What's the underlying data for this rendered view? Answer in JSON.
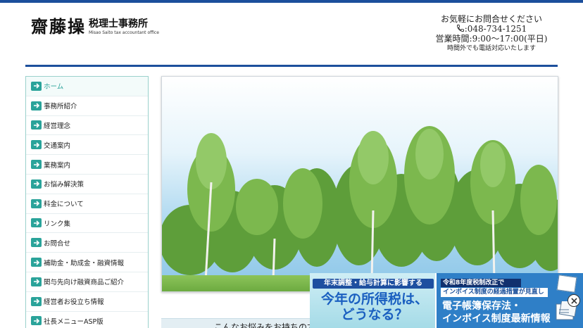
{
  "header": {
    "logo_name": "齋藤操",
    "logo_sub": "税理士事務所",
    "logo_en": "Misao Saito tax accountant office",
    "contact_line1": "お気軽にお問合せください",
    "phone": "048-734-1251",
    "hours": "営業時間:9:00～17:00(平日)",
    "after_hours": "時間外でも電話対応いたします"
  },
  "sidebar": {
    "items": [
      {
        "label": "ホーム",
        "active": true
      },
      {
        "label": "事務所紹介"
      },
      {
        "label": "経営理念"
      },
      {
        "label": "交通案内"
      },
      {
        "label": "業務案内"
      },
      {
        "label": "お悩み解決策"
      },
      {
        "label": "料金について"
      },
      {
        "label": "リンク集"
      },
      {
        "label": "お問合せ"
      },
      {
        "label": "補助金・助成金・融資情報"
      },
      {
        "label": "関与先向け融資商品ご紹介"
      },
      {
        "label": "経営者お役立ち情報"
      },
      {
        "label": "社長メニューASP版"
      }
    ]
  },
  "main": {
    "intro_text": "こんなお悩みをお持ちの方"
  },
  "banner": {
    "left_strip": "年末調整・給与計算に影響する",
    "left_main": "今年の所得税は、",
    "left_sub": "どうなる？",
    "right_strip": "令和8年度税制改正で",
    "right_line2": "インボイス制度の経過措置が見直し",
    "right_line3": "電子帳簿保存法・",
    "right_line4": "インボイス制度最新情報"
  },
  "colors": {
    "brand_blue": "#1c4f9c",
    "accent_teal": "#2aa39a"
  }
}
